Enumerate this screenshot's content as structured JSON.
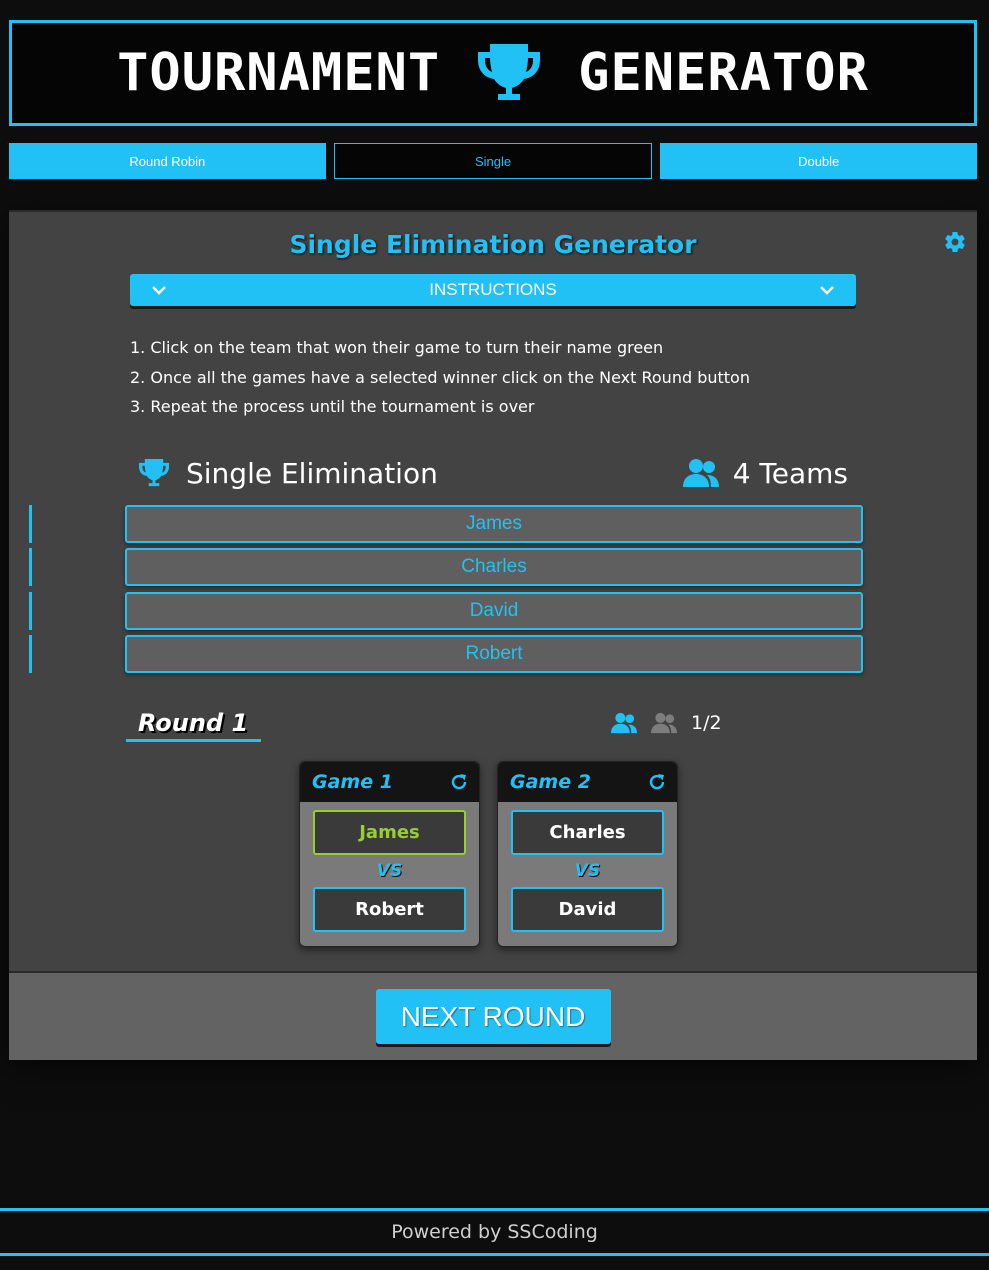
{
  "header": {
    "title_left": "TOURNAMENT",
    "title_right": "GENERATOR",
    "icon": "trophy-icon"
  },
  "tabs": [
    {
      "label": "Round Robin",
      "active": false
    },
    {
      "label": "Single",
      "active": true
    },
    {
      "label": "Double",
      "active": false
    }
  ],
  "generator": {
    "title": "Single Elimination Generator",
    "settings_icon": "gear-icon",
    "instructions_label": "INSTRUCTIONS",
    "steps": [
      "1. Click on the team that won their game to turn their name green",
      "2. Once all the games have a selected winner click on the Next Round button",
      "3. Repeat the process until the tournament is over"
    ],
    "type_label": "Single Elimination",
    "teams_label": "4 Teams",
    "teams": [
      "James",
      "Charles",
      "David",
      "Robert"
    ]
  },
  "round": {
    "title": "Round 1",
    "progress": "1/2",
    "games": [
      {
        "title": "Game 1",
        "team1": "James",
        "team2": "Robert",
        "winner": "James"
      },
      {
        "title": "Game 2",
        "team1": "Charles",
        "team2": "David",
        "winner": null
      }
    ],
    "vs_label": "VS"
  },
  "actions": {
    "next_round_label": "NEXT ROUND"
  },
  "footer": {
    "text": "Powered by SSCoding"
  },
  "colors": {
    "accent": "#22c1f5",
    "winner": "#9acd32",
    "background": "#0d0d0d",
    "panel": "#434343"
  }
}
